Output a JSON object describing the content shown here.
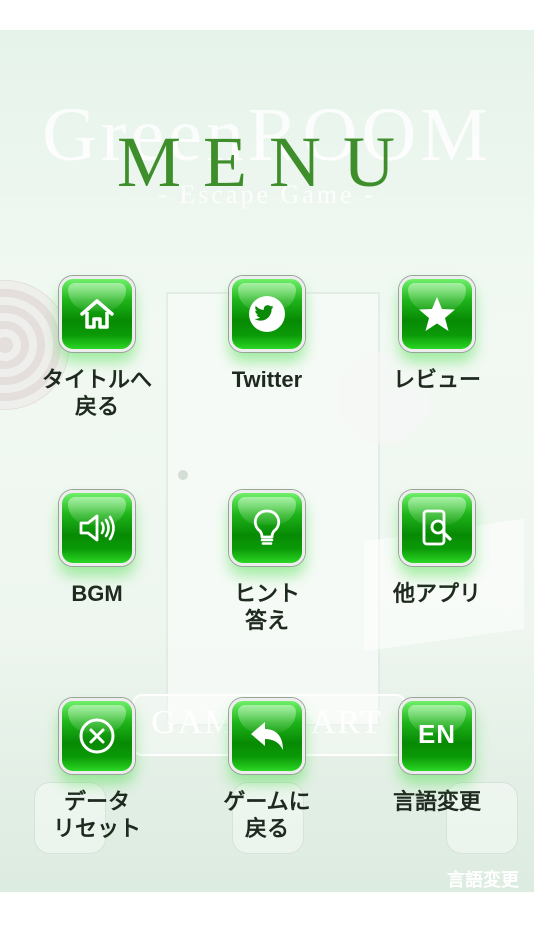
{
  "background": {
    "game_title": "GreenROOM",
    "game_subtitle": "- Escape Game -",
    "start_button": "GAME START",
    "bottom_right_label": "言語変更"
  },
  "menu": {
    "title": "MENU",
    "items": [
      {
        "label": "タイトルへ\n戻る",
        "icon": "home-icon"
      },
      {
        "label": "Twitter",
        "icon": "twitter-icon"
      },
      {
        "label": "レビュー",
        "icon": "star-icon"
      },
      {
        "label": "BGM",
        "icon": "speaker-icon"
      },
      {
        "label": "ヒント\n答え",
        "icon": "lightbulb-icon"
      },
      {
        "label": "他アプリ",
        "icon": "phone-search-icon"
      },
      {
        "label": "データ\nリセット",
        "icon": "close-circle-icon"
      },
      {
        "label": "ゲームに\n戻る",
        "icon": "back-arrow-icon"
      },
      {
        "label": "言語変更",
        "icon": "en-icon",
        "badge": "EN"
      }
    ]
  },
  "colors": {
    "title_green": "#3f8e2c",
    "button_green": "#078a04",
    "label_text": "#1f2a1f"
  }
}
